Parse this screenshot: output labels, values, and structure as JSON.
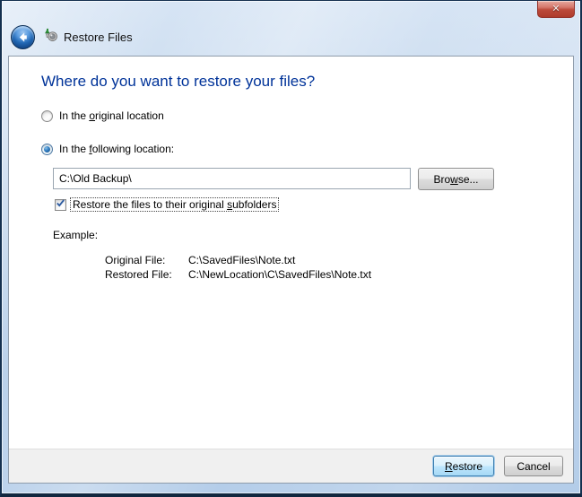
{
  "window": {
    "close_glyph": "✕"
  },
  "header": {
    "title": "Restore Files"
  },
  "main": {
    "heading": "Where do you want to restore your files?",
    "radio_original": {
      "pre": "In the ",
      "key": "o",
      "post": "riginal location",
      "selected": false
    },
    "radio_following": {
      "pre": "In the ",
      "key": "f",
      "post": "ollowing location:",
      "selected": true
    },
    "path_input": {
      "value": "C:\\Old Backup\\"
    },
    "browse_button": {
      "pre": "Bro",
      "key": "w",
      "post": "se..."
    },
    "subfolders_checkbox": {
      "pre": "Restore the files to their original ",
      "key": "s",
      "post": "ubfolders",
      "checked": true
    },
    "example": {
      "label": "Example:",
      "rows": [
        {
          "name": "Original File:",
          "value": "C:\\SavedFiles\\Note.txt"
        },
        {
          "name": "Restored File:",
          "value": "C:\\NewLocation\\C\\SavedFiles\\Note.txt"
        }
      ]
    }
  },
  "footer": {
    "restore_button": {
      "pre": "",
      "key": "R",
      "post": "estore"
    },
    "cancel_button": {
      "label": "Cancel"
    }
  },
  "colors": {
    "heading_blue": "#003399",
    "glass_blue": "#c2d6ec",
    "close_red": "#bc4a3a",
    "footer_gray": "#f0f0f0",
    "default_button_border": "#3c7fb1"
  }
}
